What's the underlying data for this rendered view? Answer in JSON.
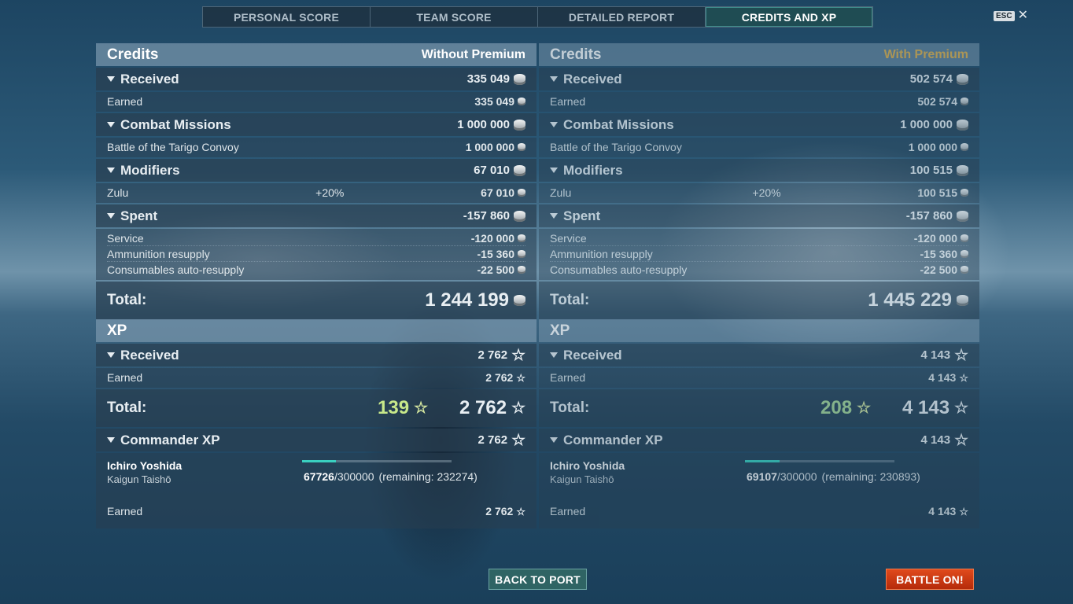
{
  "tabs": [
    "PERSONAL SCORE",
    "TEAM SCORE",
    "DETAILED REPORT",
    "CREDITS AND XP"
  ],
  "esc": {
    "key": "ESC",
    "close": "✕"
  },
  "left": {
    "credits_title": "Credits",
    "credits_sub": "Without Premium",
    "received": {
      "label": "Received",
      "value": "335 049",
      "earned_label": "Earned",
      "earned_value": "335 049"
    },
    "missions": {
      "label": "Combat Missions",
      "value": "1 000 000",
      "item_label": "Battle of the Tarigo Convoy",
      "item_value": "1 000 000"
    },
    "modifiers": {
      "label": "Modifiers",
      "value": "67 010",
      "item_label": "Zulu",
      "item_pct": "+20%",
      "item_value": "67 010"
    },
    "spent": {
      "label": "Spent",
      "value": "-157 860",
      "items": [
        {
          "label": "Service",
          "value": "-120 000"
        },
        {
          "label": "Ammunition resupply",
          "value": "-15 360"
        },
        {
          "label": "Consumables auto-resupply",
          "value": "-22 500"
        }
      ]
    },
    "total_label": "Total:",
    "total_credits": "1 244 199",
    "xp_title": "XP",
    "xp_received": {
      "label": "Received",
      "value": "2 762",
      "earned_label": "Earned",
      "earned_value": "2 762"
    },
    "xp_total_bonus": "139",
    "xp_total": "2 762",
    "commander": {
      "label": "Commander XP",
      "value": "2 762",
      "name": "Ichiro Yoshida",
      "rank": "Kaigun Taishō",
      "current": "67726",
      "max": "/300000",
      "remaining": "(remaining: 232274)",
      "progress": 0.2258,
      "earned_label": "Earned",
      "earned_value": "2 762"
    }
  },
  "right": {
    "credits_title": "Credits",
    "credits_sub": "With Premium",
    "received": {
      "label": "Received",
      "value": "502 574",
      "earned_label": "Earned",
      "earned_value": "502 574"
    },
    "missions": {
      "label": "Combat Missions",
      "value": "1 000 000",
      "item_label": "Battle of the Tarigo Convoy",
      "item_value": "1 000 000"
    },
    "modifiers": {
      "label": "Modifiers",
      "value": "100 515",
      "item_label": "Zulu",
      "item_pct": "+20%",
      "item_value": "100 515"
    },
    "spent": {
      "label": "Spent",
      "value": "-157 860",
      "items": [
        {
          "label": "Service",
          "value": "-120 000"
        },
        {
          "label": "Ammunition resupply",
          "value": "-15 360"
        },
        {
          "label": "Consumables auto-resupply",
          "value": "-22 500"
        }
      ]
    },
    "total_label": "Total:",
    "total_credits": "1 445 229",
    "xp_title": "XP",
    "xp_received": {
      "label": "Received",
      "value": "4 143",
      "earned_label": "Earned",
      "earned_value": "4 143"
    },
    "xp_total_bonus": "208",
    "xp_total": "4 143",
    "commander": {
      "label": "Commander XP",
      "value": "4 143",
      "name": "Ichiro Yoshida",
      "rank": "Kaigun Taishō",
      "current": "69107",
      "max": "/300000",
      "remaining": "(remaining: 230893)",
      "progress": 0.2304,
      "earned_label": "Earned",
      "earned_value": "4 143"
    }
  },
  "buttons": {
    "back_to_port": "BACK TO PORT",
    "battle_on": "BATTLE ON!"
  },
  "colors": {
    "premium_accent": "#e0b24f",
    "battle_button": "#d2401a",
    "active_tab": "#205056",
    "progress": "#3ad0c0",
    "xp_bonus": "#c7e88a"
  },
  "icons": {
    "credits": "silver-coin-icon",
    "xp": "star-icon",
    "collapse": "triangle-down-icon"
  }
}
